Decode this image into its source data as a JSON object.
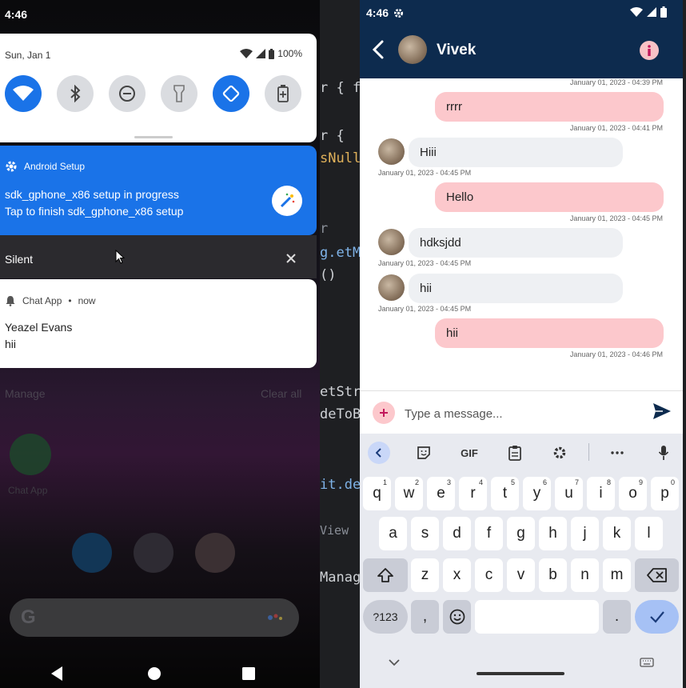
{
  "left_phone": {
    "status_time": "4:46",
    "quick_settings": {
      "date": "Sun, Jan 1",
      "battery": "100%"
    },
    "setup_notification": {
      "app": "Android Setup",
      "line1": "sdk_gphone_x86 setup in progress",
      "line2": "Tap to finish sdk_gphone_x86 setup"
    },
    "silent_label": "Silent",
    "chat_notification": {
      "app": "Chat App",
      "when": "now",
      "title": "Yeazel Evans",
      "text": "hii"
    },
    "manage_label": "Manage",
    "clear_all_label": "Clear all",
    "home_app_label": "Chat App"
  },
  "ide_fragments": [
    {
      "text": "r { f",
      "top": 0
    },
    {
      "text": "r {",
      "top": 0
    },
    {
      "text": "sNull",
      "top": 0
    },
    {
      "text": "r",
      "top": 0
    },
    {
      "text": "g.etM",
      "top": 0
    },
    {
      "text": "()",
      "top": 0
    },
    {
      "text": "etStr",
      "top": 0
    },
    {
      "text": "deToB",
      "top": 0
    },
    {
      "text": "it.de",
      "top": 0
    },
    {
      "text": "View",
      "top": 0
    },
    {
      "text": "Manag",
      "top": 0
    }
  ],
  "chat": {
    "status_time": "4:46",
    "contact_name": "Vivek",
    "messages": [
      {
        "side": "sent",
        "text": "",
        "time": "January 01, 2023 - 04:39 PM"
      },
      {
        "side": "sent",
        "text": "rrrr",
        "time": "January 01, 2023 - 04:41 PM"
      },
      {
        "side": "recv",
        "text": "Hiii",
        "time": "January 01, 2023 - 04:45 PM"
      },
      {
        "side": "sent",
        "text": "Hello",
        "time": "January 01, 2023 - 04:45 PM"
      },
      {
        "side": "recv",
        "text": "hdksjdd",
        "time": "January 01, 2023 - 04:45 PM"
      },
      {
        "side": "recv",
        "text": "hii",
        "time": "January 01, 2023 - 04:45 PM"
      },
      {
        "side": "sent",
        "text": "hii",
        "time": "January 01, 2023 - 04:46 PM"
      }
    ],
    "input_placeholder": "Type a message..."
  },
  "keyboard": {
    "toolbar": {
      "gif": "GIF"
    },
    "row1": [
      {
        "k": "q",
        "n": "1"
      },
      {
        "k": "w",
        "n": "2"
      },
      {
        "k": "e",
        "n": "3"
      },
      {
        "k": "r",
        "n": "4"
      },
      {
        "k": "t",
        "n": "5"
      },
      {
        "k": "y",
        "n": "6"
      },
      {
        "k": "u",
        "n": "7"
      },
      {
        "k": "i",
        "n": "8"
      },
      {
        "k": "o",
        "n": "9"
      },
      {
        "k": "p",
        "n": "0"
      }
    ],
    "row2": [
      "a",
      "s",
      "d",
      "f",
      "g",
      "h",
      "j",
      "k",
      "l"
    ],
    "row3": [
      "z",
      "x",
      "c",
      "v",
      "b",
      "n",
      "m"
    ],
    "symbols_key": "?123",
    "comma_key": ",",
    "period_key": "."
  }
}
